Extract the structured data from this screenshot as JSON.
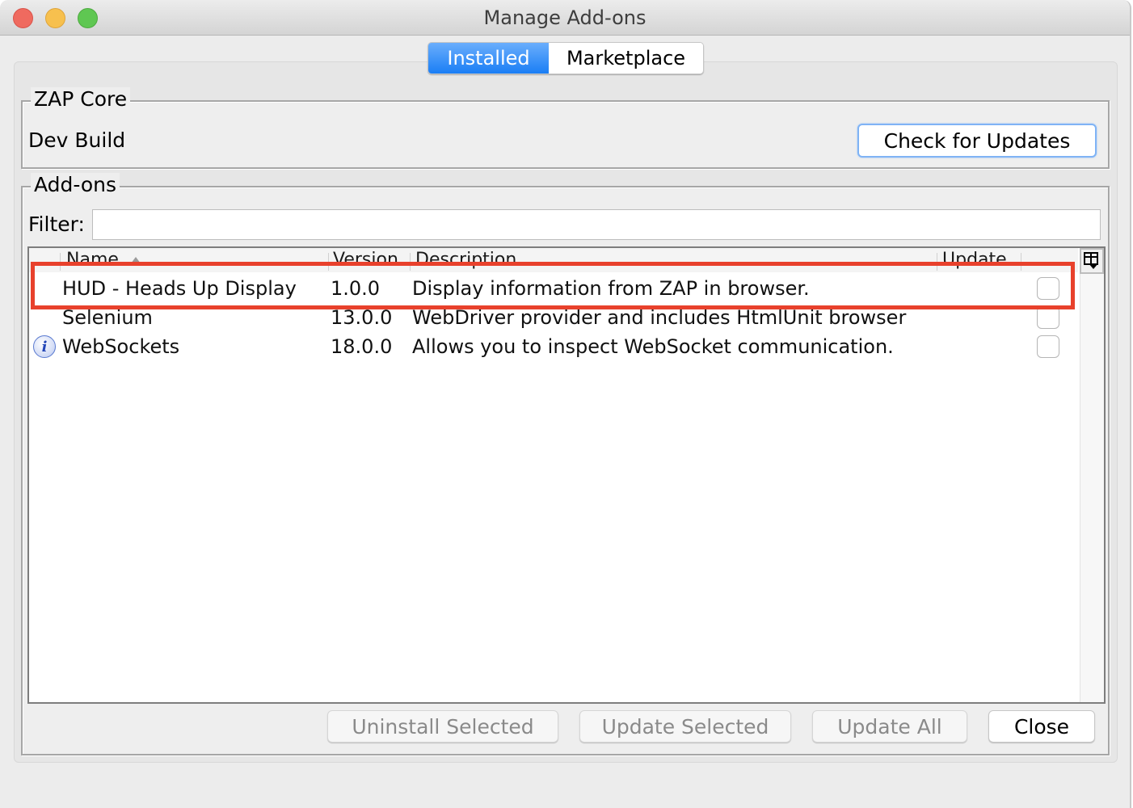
{
  "window": {
    "title": "Manage Add-ons",
    "controls": [
      "close",
      "minimize",
      "maximize"
    ]
  },
  "tabs": [
    {
      "label": "Installed",
      "active": true
    },
    {
      "label": "Marketplace",
      "active": false
    }
  ],
  "zap_core": {
    "legend": "ZAP Core",
    "build_label": "Dev Build",
    "check_updates_label": "Check for Updates"
  },
  "addons": {
    "legend": "Add-ons",
    "filter": {
      "label": "Filter:",
      "value": "",
      "placeholder": ""
    },
    "columns": [
      {
        "label": "Name",
        "sorted": "ascending"
      },
      {
        "label": "Version"
      },
      {
        "label": "Description"
      },
      {
        "label": "Update"
      }
    ],
    "rows": [
      {
        "icon": "",
        "name": "HUD - Heads Up Display",
        "version": "1.0.0",
        "description": "Display information from ZAP in browser.",
        "update": false,
        "highlighted": true
      },
      {
        "icon": "",
        "name": "Selenium",
        "version": "13.0.0",
        "description": "WebDriver provider and includes HtmlUnit browser",
        "update": false,
        "highlighted": false
      },
      {
        "icon": "info-icon",
        "name": "WebSockets",
        "version": "18.0.0",
        "description": "Allows you to inspect WebSocket communication.",
        "update": false,
        "highlighted": false
      }
    ],
    "info_glyph": "i"
  },
  "buttons": {
    "uninstall_selected": "Uninstall Selected",
    "update_selected": "Update Selected",
    "update_all": "Update All",
    "close": "Close"
  },
  "colors": {
    "accent": "#1a7ef5",
    "highlight": "#e8412c"
  }
}
